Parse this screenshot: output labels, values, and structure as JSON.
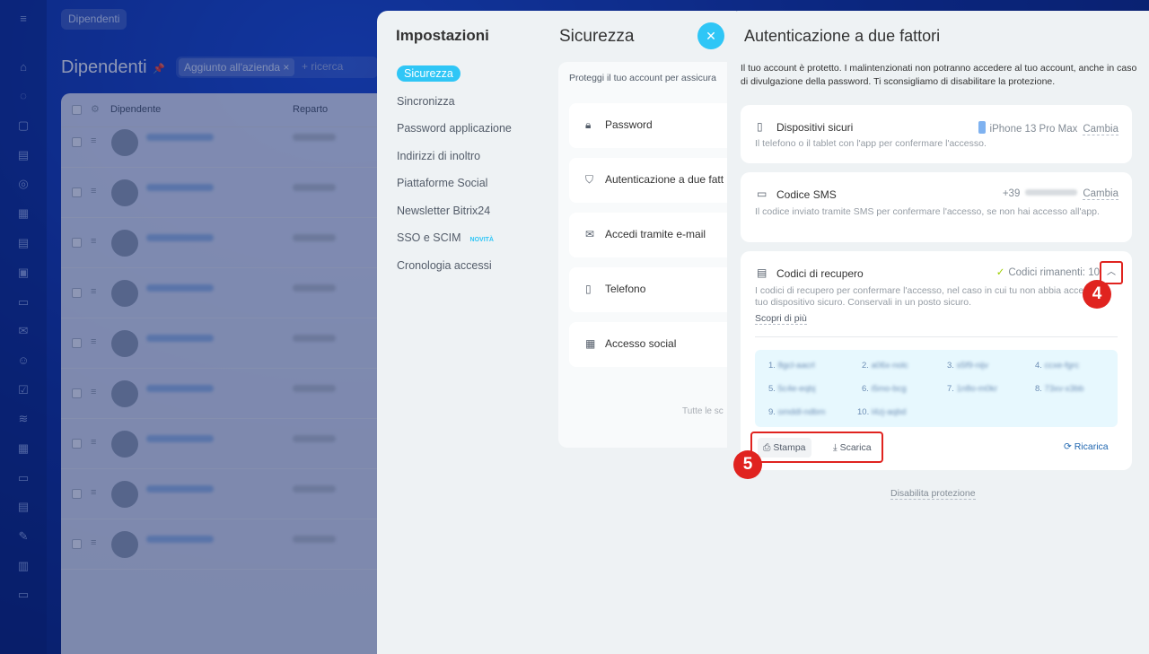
{
  "background": {
    "top_chip": "Dipendenti",
    "page_title": "Dipendenti",
    "filter_tag": "Aggiunto all'azienda",
    "filter_placeholder": "+ ricerca",
    "table": {
      "col_dipendente": "Dipendente",
      "col_reparto": "Reparto"
    }
  },
  "settings": {
    "title": "Impostazioni",
    "nav": [
      {
        "label": "Sicurezza"
      },
      {
        "label": "Sincronizza"
      },
      {
        "label": "Password applicazione"
      },
      {
        "label": "Indirizzi di inoltro"
      },
      {
        "label": "Piattaforme Social"
      },
      {
        "label": "Newsletter Bitrix24"
      },
      {
        "label": "SSO e SCIM",
        "badge": "NOVITÀ"
      },
      {
        "label": "Cronologia accessi"
      }
    ],
    "section_title": "Sicurezza",
    "section_desc": "Proteggi il tuo account per assicura",
    "items": [
      {
        "label": "Password",
        "icon": "lock-icon"
      },
      {
        "label": "Autenticazione a due fatt",
        "icon": "shield-icon"
      },
      {
        "label": "Accedi tramite e-mail",
        "icon": "mail-icon"
      },
      {
        "label": "Telefono",
        "icon": "phone-icon"
      },
      {
        "label": "Accesso social",
        "icon": "grid-icon"
      }
    ],
    "tutorial_fragment": "Tutte le sc"
  },
  "panel": {
    "title": "Autenticazione a due fattori",
    "intro": "Il tuo account è protetto. I malintenzionati non potranno accedere al tuo account, anche in caso di divulgazione della password. Ti sconsigliamo di disabilitare la protezione.",
    "devices": {
      "label": "Dispositivi sicuri",
      "desc": "Il telefono o il tablet con l'app per confermare l'accesso.",
      "device_name": "iPhone 13 Pro Max",
      "change": "Cambia"
    },
    "sms": {
      "label": "Codice SMS",
      "desc": "Il codice inviato tramite SMS per confermare l'accesso, se non hai accesso all'app.",
      "prefix": "+39",
      "change": "Cambia"
    },
    "recovery": {
      "label": "Codici di recupero",
      "remaining": "Codici rimanenti: 10",
      "desc": "I codici di recupero per confermare l'accesso, nel caso in cui tu non abbia accesso al tuo dispositivo sicuro. Conservali in un posto sicuro.",
      "learn_more": "Scopri di più",
      "codes": [
        {
          "n": "1.",
          "v": "8gcl-aacrl"
        },
        {
          "n": "2.",
          "v": "a06x-nolc"
        },
        {
          "n": "3.",
          "v": "s5f9-nijv"
        },
        {
          "n": "4.",
          "v": "ccxe-fgrc"
        },
        {
          "n": "5.",
          "v": "5c4e-eqbj"
        },
        {
          "n": "6.",
          "v": "i5mo-bcg"
        },
        {
          "n": "7.",
          "v": "1n8o-m0kr"
        },
        {
          "n": "8.",
          "v": "73xv-x3bb"
        },
        {
          "n": "9.",
          "v": "omddl-ndbm"
        },
        {
          "n": "10.",
          "v": "l4zj-aqbd"
        }
      ],
      "print": "Stampa",
      "download": "Scarica",
      "reload": "Ricarica"
    },
    "disable": "Disabilita protezione"
  },
  "markers": {
    "m4": "4",
    "m5": "5"
  },
  "colors": {
    "accent": "#2fc6f6",
    "highlight": "#e0231f",
    "link": "#2067b0"
  }
}
